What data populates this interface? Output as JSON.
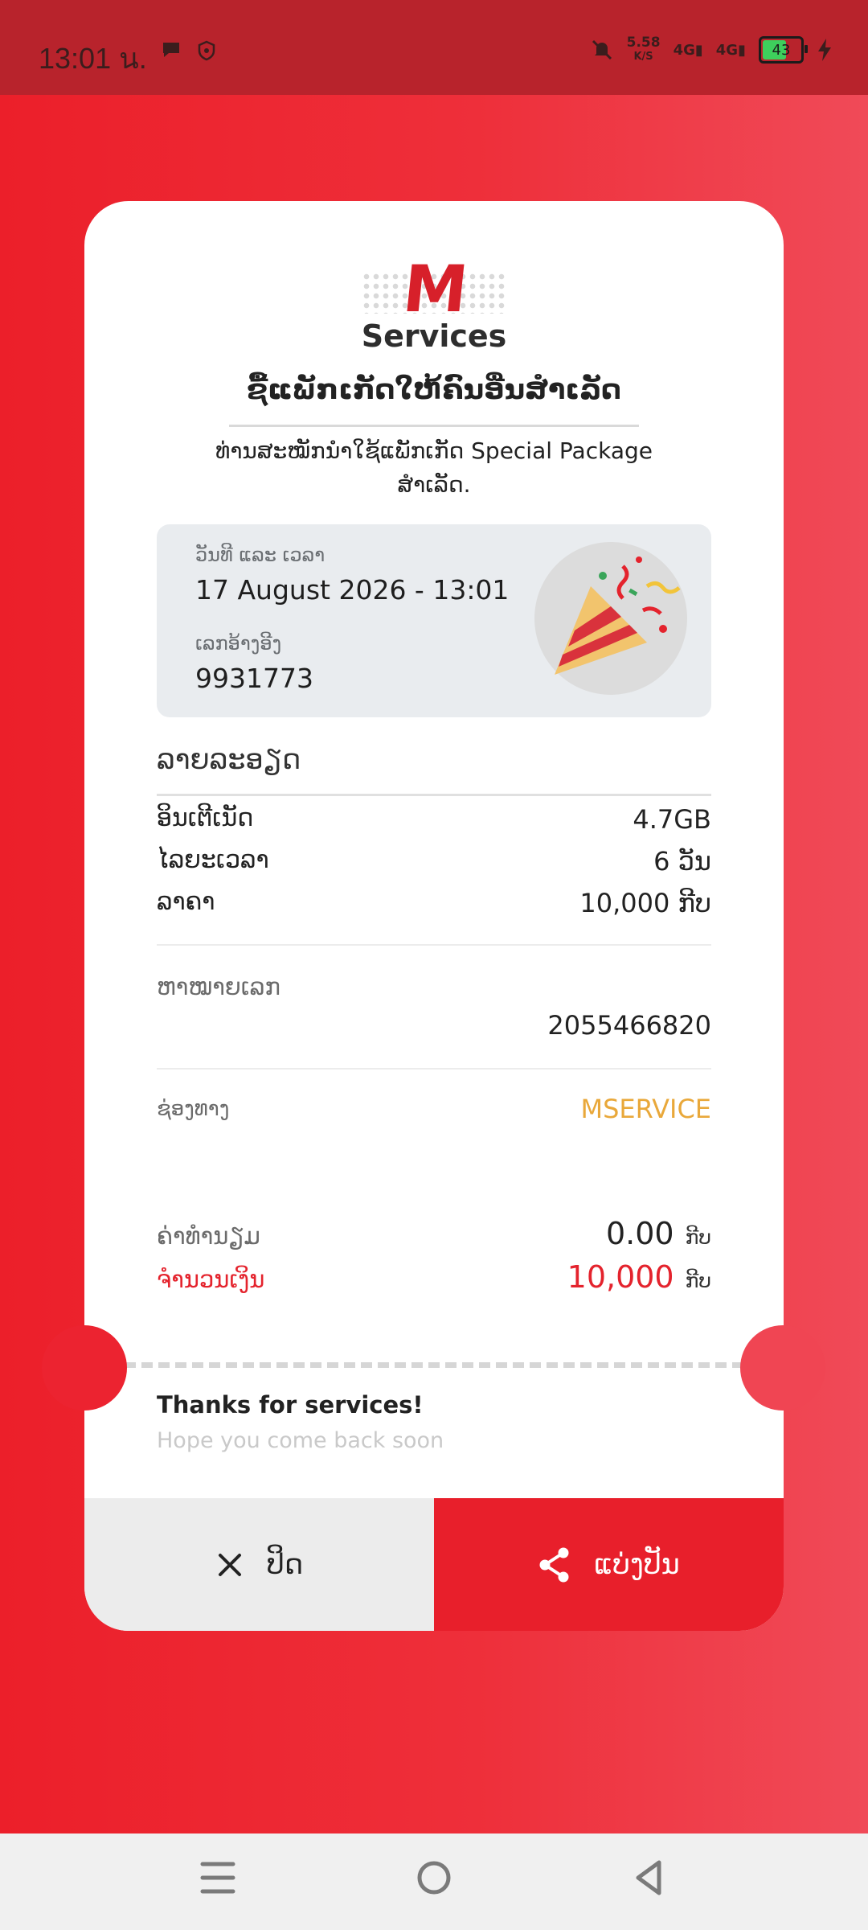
{
  "status_bar": {
    "time": "13:01 น.",
    "speed_value": "5.58",
    "speed_unit": "K/S",
    "net1": "4G",
    "net2": "4G",
    "battery": "43"
  },
  "brand": {
    "logo_letter": "M",
    "logo_text": "Services",
    "primary_color": "#e81f2b",
    "accent_color": "#e9a83a"
  },
  "receipt": {
    "headline": "ຊື້ແພັກເກັດໃຫ້ຄົນອື່ນສຳເລັດ",
    "subline": "ທ່ານສະໝັກນຳໃຊ້ແພັກເກັດ Special Package ສຳເລັດ.",
    "info": {
      "datetime_label": "ວັນທີ ແລະ ເວລາ",
      "datetime_value": "17 August 2026 - 13:01",
      "ref_label": "ເລກອ້າງອີງ",
      "ref_value": "9931773"
    },
    "details_title": "ລາຍລະອຽດ",
    "details": [
      {
        "label": "ອິນເຕີເນັດ",
        "value": "4.7GB"
      },
      {
        "label": "ໄລຍະເວລາ",
        "value": "6 ວັນ"
      },
      {
        "label": "ລາຄາ",
        "value": "10,000 ກີບ"
      }
    ],
    "recipient_label": "ຫາໝາຍເລກ",
    "recipient_value": "2055466820",
    "channel_label": "ຊ່ອງທາງ",
    "channel_value": "MSERVICE",
    "fee_label": "ຄ່າທຳນຽມ",
    "fee_value": "0.00",
    "fee_unit": "ກີບ",
    "total_label": "ຈຳນວນເງິນ",
    "total_value": "10,000",
    "total_unit": "ກີບ",
    "thanks_title": "Thanks for services!",
    "thanks_sub": "Hope you come back soon"
  },
  "actions": {
    "close_label": "ປິດ",
    "share_label": "ແບ່ງປັນ"
  }
}
